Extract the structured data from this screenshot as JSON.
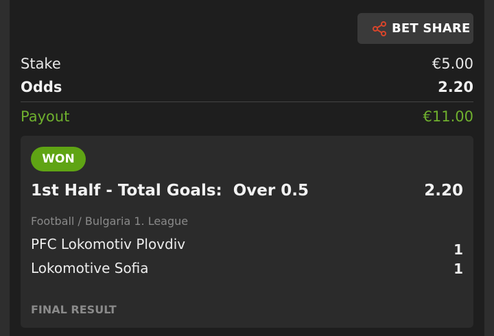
{
  "share": {
    "label": "BET SHARE",
    "icon": "share-icon",
    "icon_color": "#d9452b"
  },
  "summary": {
    "stake_label": "Stake",
    "stake_value": "€5.00",
    "odds_label": "Odds",
    "odds_value": "2.20",
    "payout_label": "Payout",
    "payout_value": "€11.00",
    "payout_color": "#6fb02e"
  },
  "selection": {
    "status": "WON",
    "status_color": "#5fa414",
    "market": "1st Half - Total Goals:  Over 0.5",
    "odds": "2.20",
    "league": "Football / Bulgaria 1. League",
    "teams": [
      {
        "name": "PFC Lokomotiv Plovdiv",
        "score": "1"
      },
      {
        "name": "Lokomotive Sofia",
        "score": "1"
      }
    ],
    "result_label": "FINAL RESULT"
  }
}
